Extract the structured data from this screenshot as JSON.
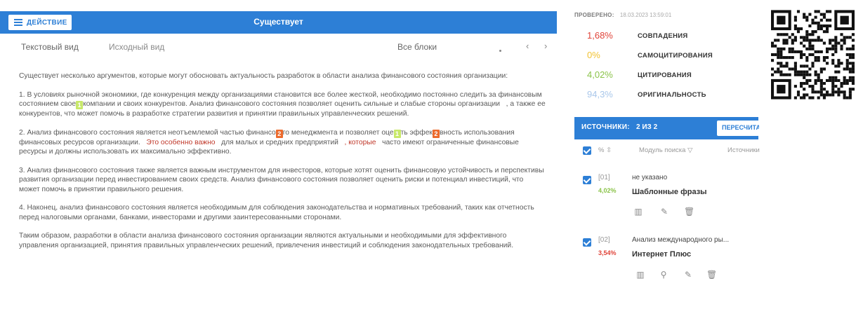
{
  "doc": {
    "action_label": "ДЕЙСТВИЕ",
    "title": "Существует",
    "tab_text": "Текстовый вид",
    "tab_source": "Исходный вид",
    "blocks": "Все блоки",
    "nav_prev": "‹",
    "nav_next": "›",
    "paragraphs": {
      "p0": "Существует несколько аргументов, которые могут обосновать актуальность разработок в области анализа финансового состояния организации:",
      "p1a": "1. В условиях рыночной экономики, где конкуренция между организациями становится все более жесткой, необходимо постоянно следить за финансовым состоянием свое",
      "p1b": "компании и своих конкурентов. Анализ финансового состояния позволяет оценить сильные и слабые стороны организации",
      "p1c": ", а также ее конкурентов, что может помочь в разработке стратегии развития и принятии правильных управленческих решений.",
      "p2a": "2. Анализ финансового состояния является неотъемлемой частью финансо",
      "p2b": "го менеджмента и позволяет оце",
      "p2c": "ть эффек",
      "p2d": "вность использования финансовых ресурсов организации.",
      "p2e": "Это особенно важно",
      "p2f": "для малых и средних предприятий",
      "p2g": ", которые",
      "p2h": "часто имеют ограниченные финансовые ресурсы и должны использовать их максимально эффективно.",
      "p3": "3. Анализ финансового состояния также является важным инструментом для инвесторов, которые хотят оценить финансовую устойчивость и перспективы развития организации перед инвестированием своих средств. Анализ финансового состояния позволяет оценить риски и потенциал инвестиций, что может помочь в принятии правильного решения.",
      "p4": "4. Наконец, анализ финансового состояния является необходимым для соблюдения законодательства и нормативных требований, таких как отчетность перед налоговыми органами, банками, инвесторами и другими заинтересованными сторонами.",
      "p5": "Таким образом, разработки в области анализа финансового состояния организации являются актуальными и необходимыми для эффективного управления организацией, принятия правильных управленческих решений, привлечения инвестиций и соблюдения законодательных требований."
    },
    "markers": {
      "m1": "1",
      "m2": "2",
      "m3": "1",
      "m4": "2"
    }
  },
  "report": {
    "checked_label": "ПРОВЕРЕНО:",
    "checked_date": "18.03.2023 13:59:01",
    "stats": [
      {
        "value": "1,68%",
        "label": "совпадения",
        "color": "#e0443a"
      },
      {
        "value": "0%",
        "label": "самоцитирования",
        "color": "#f1c232"
      },
      {
        "value": "4,02%",
        "label": "цитирования",
        "color": "#8bc34a"
      },
      {
        "value": "94,3%",
        "label": "оригинальность",
        "color": "#a9c7ea"
      }
    ],
    "sources_title": "ИСТОЧНИКИ:",
    "sources_count": "2 ИЗ 2",
    "recalc": "ПЕРЕСЧИТА",
    "col_pct": "%",
    "col_module": "Модуль поиска",
    "col_sources": "Источники",
    "sources": [
      {
        "idx": "[01]",
        "pct": "4,02%",
        "name": "не указано",
        "module": "Шаблонные фразы",
        "pct_color": "#8bc34a"
      },
      {
        "idx": "[02]",
        "pct": "3,54%",
        "name": "Анализ международного ры...",
        "module": "Интернет Плюс",
        "pct_color": "#e0443a"
      }
    ]
  }
}
